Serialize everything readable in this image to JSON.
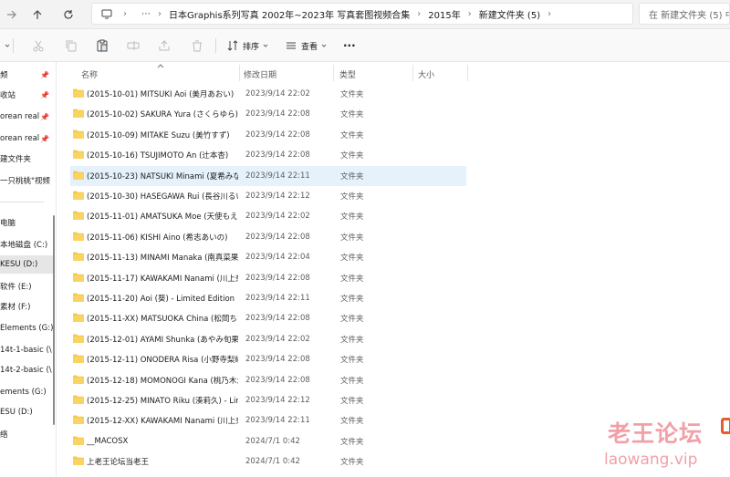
{
  "address": {
    "ellipsis": "⋯",
    "crumbs": [
      "日本Graphis系列写真 2002年~2023年 写真套图视频合集",
      "2015年",
      "新建文件夹 (5)"
    ],
    "separator": "›"
  },
  "search": {
    "placeholder": "在 新建文件夹 (5) 中"
  },
  "toolbar": {
    "sort_label": "排序",
    "view_label": "查看",
    "more_label": "···"
  },
  "sidebar": {
    "items": [
      {
        "label": "频",
        "pinned": true
      },
      {
        "label": "收站",
        "pinned": true
      },
      {
        "label": "orean real",
        "pinned": true
      },
      {
        "label": "orean real",
        "pinned": true
      },
      {
        "label": "建文件夹",
        "pinned": false
      },
      {
        "label": "一只桃桃\"视频",
        "pinned": false
      },
      {
        "label": "电脑",
        "pinned": false
      },
      {
        "label": "本地磁盘 (C:)",
        "pinned": false
      },
      {
        "label": "KESU (D:)",
        "pinned": false
      },
      {
        "label": "软件 (E:)",
        "pinned": false
      },
      {
        "label": "素材 (F:)",
        "pinned": false
      },
      {
        "label": "Elements (G:)",
        "pinned": false
      },
      {
        "label": "14t-1-basic (\\",
        "pinned": false
      },
      {
        "label": "14t-2-basic (\\",
        "pinned": false
      },
      {
        "label": "ements (G:)",
        "pinned": false
      },
      {
        "label": "ESU (D:)",
        "pinned": false
      },
      {
        "label": "络",
        "pinned": false
      }
    ]
  },
  "columns": {
    "name": "名称",
    "date": "修改日期",
    "type": "类型",
    "size": "大小"
  },
  "files": [
    {
      "name": "(2015-10-01) MITSUKI Aoi (美月あおい)",
      "date": "2023/9/14 22:02",
      "type": "文件夹",
      "size": ""
    },
    {
      "name": "(2015-10-02) SAKURA Yura (さくらゆら)",
      "date": "2023/9/14 22:08",
      "type": "文件夹",
      "size": ""
    },
    {
      "name": "(2015-10-09) MITAKE Suzu (美竹すず)",
      "date": "2023/9/14 22:08",
      "type": "文件夹",
      "size": ""
    },
    {
      "name": "(2015-10-16) TSUJIMOTO An (辻本杏)",
      "date": "2023/9/14 22:08",
      "type": "文件夹",
      "size": ""
    },
    {
      "name": "(2015-10-23) NATSUKI Minami (夏希みなみ)",
      "date": "2023/9/14 22:11",
      "type": "文件夹",
      "size": ""
    },
    {
      "name": "(2015-10-30) HASEGAWA Rui (長谷川るい)",
      "date": "2023/9/14 22:12",
      "type": "文件夹",
      "size": ""
    },
    {
      "name": "(2015-11-01) AMATSUKA Moe (天使もえ)",
      "date": "2023/9/14 22:02",
      "type": "文件夹",
      "size": ""
    },
    {
      "name": "(2015-11-06) KISHI Aino (希志あいの)",
      "date": "2023/9/14 22:08",
      "type": "文件夹",
      "size": ""
    },
    {
      "name": "(2015-11-13) MINAMI Manaka (南真菜果)",
      "date": "2023/9/14 22:04",
      "type": "文件夹",
      "size": ""
    },
    {
      "name": "(2015-11-17) KAWAKAMI Nanami (川上奈々美)",
      "date": "2023/9/14 22:08",
      "type": "文件夹",
      "size": ""
    },
    {
      "name": "(2015-11-20) Aoi (葵) - Limited Edition",
      "date": "2023/9/14 22:11",
      "type": "文件夹",
      "size": ""
    },
    {
      "name": "(2015-11-XX) MATSUOKA China (松岡ちな)",
      "date": "2023/9/14 22:08",
      "type": "文件夹",
      "size": ""
    },
    {
      "name": "(2015-12-01) AYAMI Shunka (あやみ旬果)",
      "date": "2023/9/14 22:02",
      "type": "文件夹",
      "size": ""
    },
    {
      "name": "(2015-12-11) ONODERA Risa (小野寺梨紗)",
      "date": "2023/9/14 22:08",
      "type": "文件夹",
      "size": ""
    },
    {
      "name": "(2015-12-18) MOMONOGI Kana (桃乃木かな)",
      "date": "2023/9/14 22:08",
      "type": "文件夹",
      "size": ""
    },
    {
      "name": "(2015-12-25) MINATO Riku (湊莉久) - Limited",
      "date": "2023/9/14 22:12",
      "type": "文件夹",
      "size": ""
    },
    {
      "name": "(2015-12-XX) KAWAKAMI Nanami (川上奈々美)",
      "date": "2023/9/14 22:11",
      "type": "文件夹",
      "size": ""
    },
    {
      "name": "__MACOSX",
      "date": "2024/7/1 0:42",
      "type": "文件夹",
      "size": ""
    },
    {
      "name": "上老王论坛当老王",
      "date": "2024/7/1 0:42",
      "type": "文件夹",
      "size": ""
    }
  ],
  "selected_row": 4,
  "watermark": {
    "cn": "老王论坛",
    "en": "laowang.vip"
  },
  "colors": {
    "folder": "#f7c948",
    "selection": "#e5f1fb",
    "watermark": "#f2a0a8"
  }
}
